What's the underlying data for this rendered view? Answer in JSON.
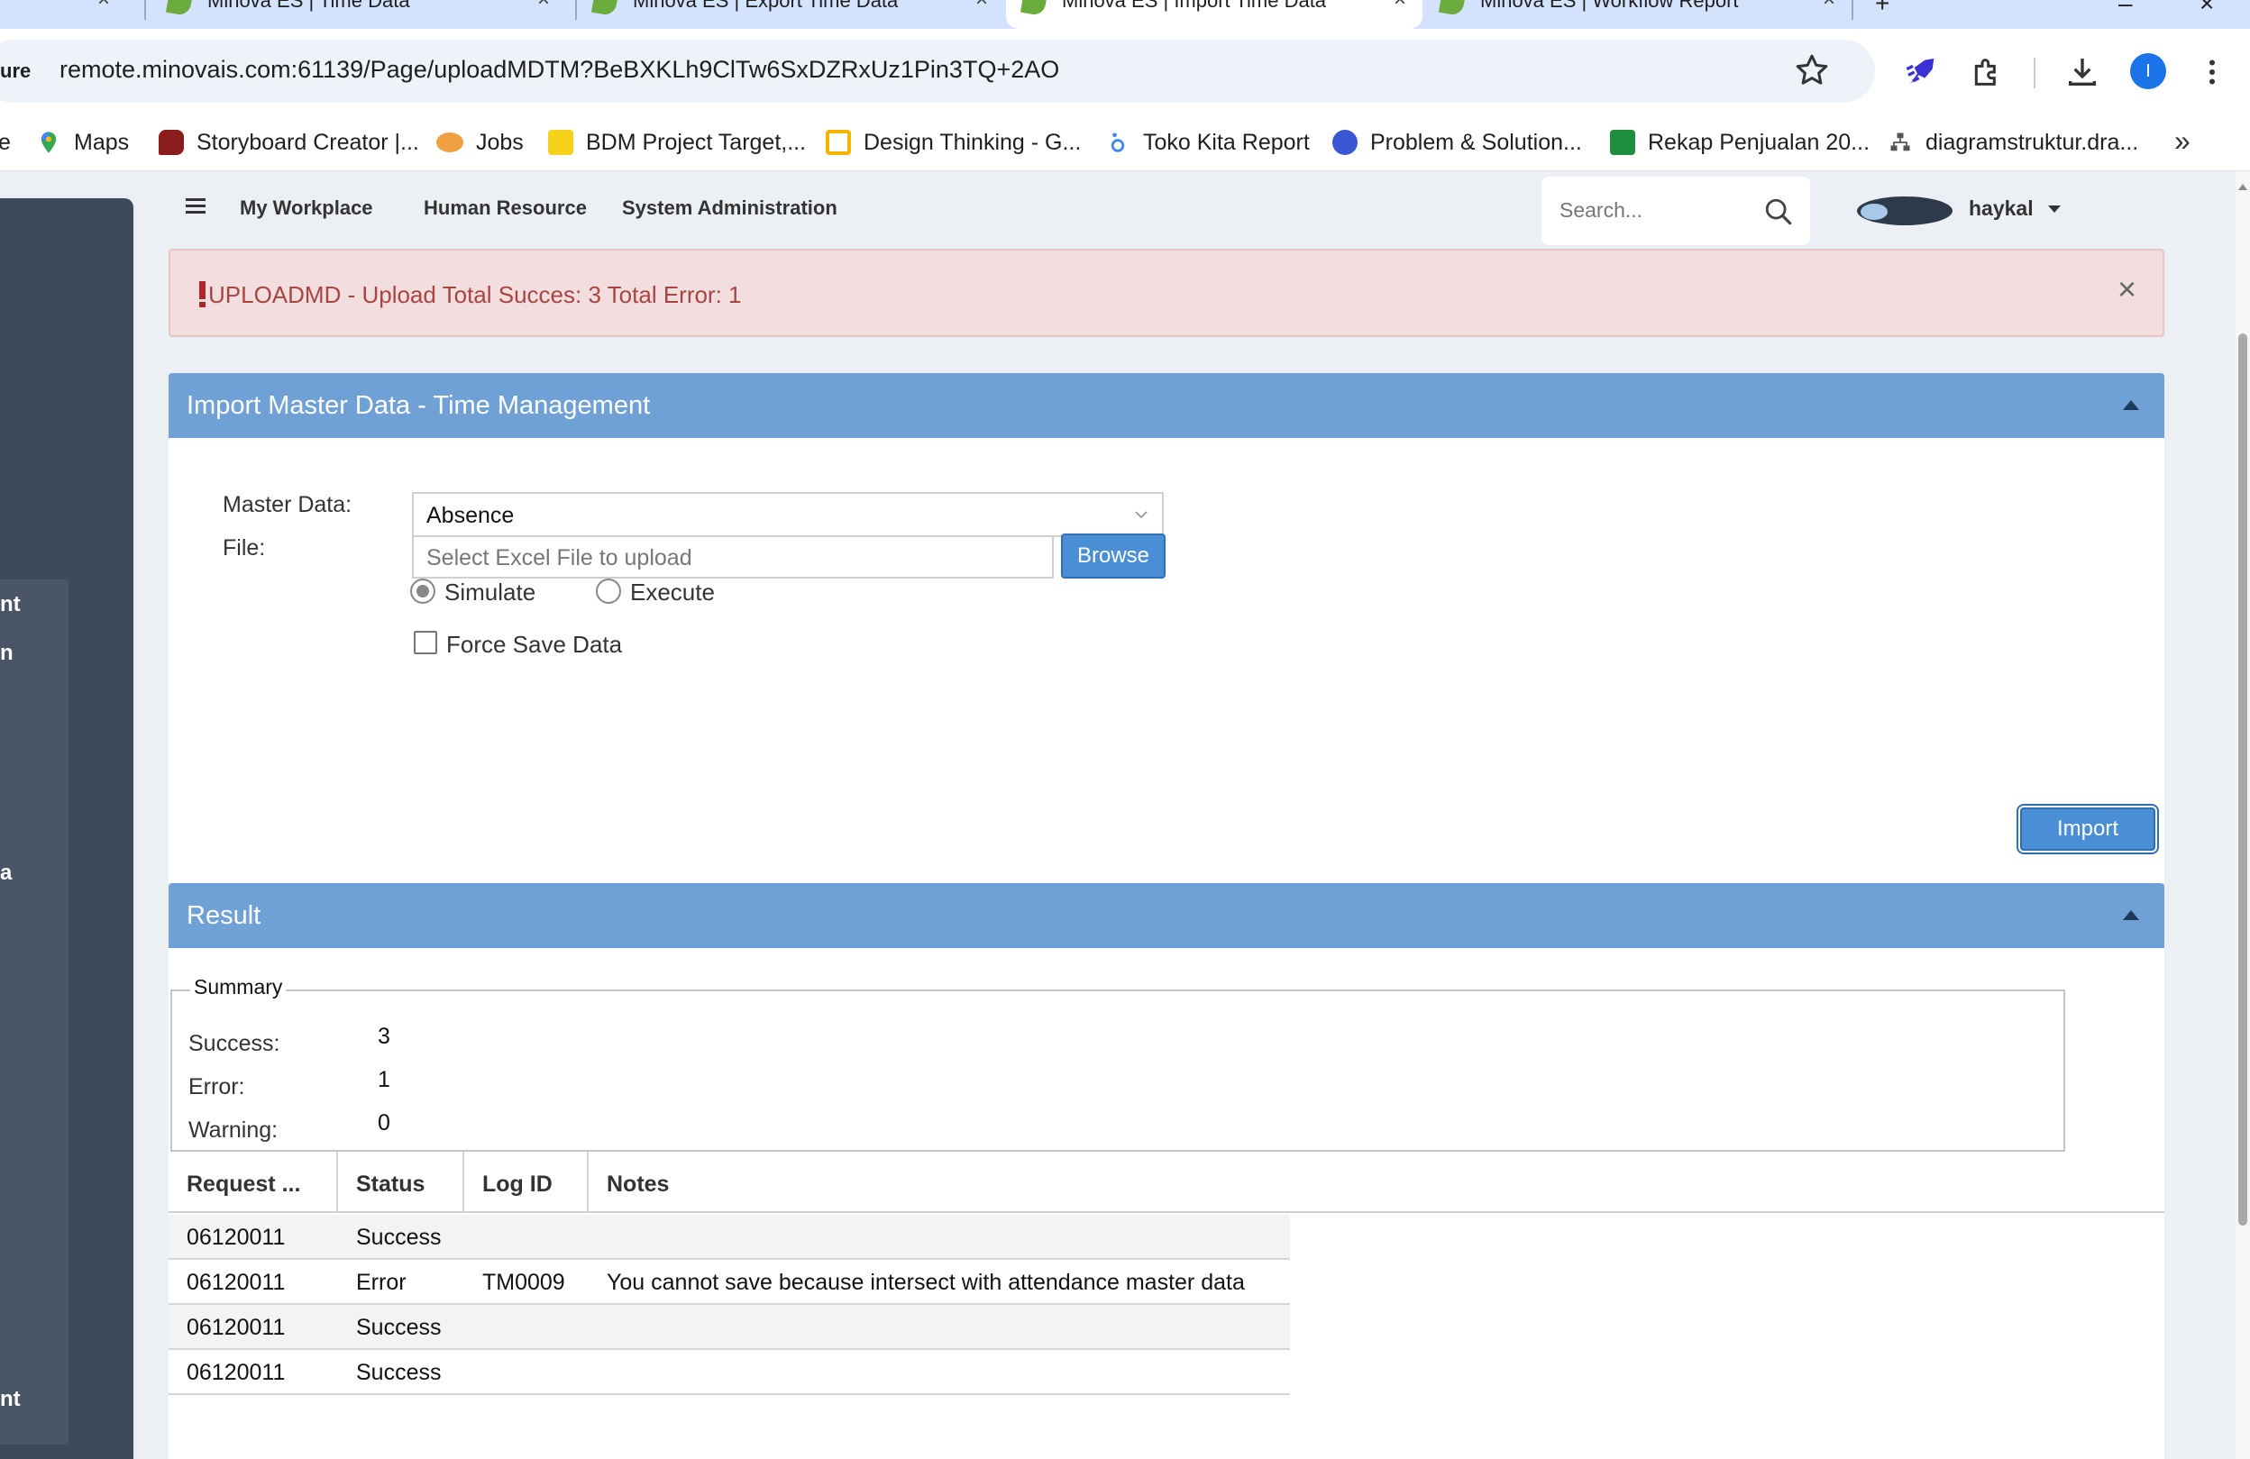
{
  "browser": {
    "tabs": [
      {
        "label": "Minova ES | Time Data"
      },
      {
        "label": "Minova ES | Export Time Data"
      },
      {
        "label": "Minova ES | Import Time Data"
      },
      {
        "label": "Minova ES | Workflow Report"
      }
    ],
    "url_secure_fragment": "ure",
    "url": "remote.minovais.com:61139/Page/uploadMDTM?BeBXKLh9ClTw6SxDZRxUz1Pin3TQ+2AO",
    "profile_initial": "I",
    "bookmarks": [
      {
        "label": "e"
      },
      {
        "label": "Maps"
      },
      {
        "label": "Storyboard Creator |..."
      },
      {
        "label": "Jobs"
      },
      {
        "label": "BDM Project Target,..."
      },
      {
        "label": "Design Thinking - G..."
      },
      {
        "label": "Toko Kita Report"
      },
      {
        "label": "Problem & Solution..."
      },
      {
        "label": "Rekap Penjualan 20..."
      },
      {
        "label": "diagramstruktur.dra..."
      }
    ],
    "more_bookmarks": "»"
  },
  "sidebar": {
    "fragments": [
      "nt",
      "n",
      "a",
      "nt"
    ]
  },
  "topnav": {
    "links": [
      "My Workplace",
      "Human Resource",
      "System Administration"
    ],
    "search_placeholder": "Search...",
    "user_name": "haykal"
  },
  "alert": {
    "message": "UPLOADMD - Upload Total Succes: 3 Total Error: 1",
    "close": "×"
  },
  "import_panel": {
    "title": "Import Master Data - Time Management",
    "master_data_label": "Master Data:",
    "master_data_value": "Absence",
    "file_label": "File:",
    "file_placeholder": "Select Excel File to upload",
    "browse_label": "Browse",
    "mode_options": [
      {
        "label": "Simulate",
        "checked": true
      },
      {
        "label": "Execute",
        "checked": false
      }
    ],
    "force_save_label": "Force Save Data",
    "force_save_checked": false,
    "import_label": "Import"
  },
  "result_panel": {
    "title": "Result",
    "summary": {
      "legend": "Summary",
      "items": [
        {
          "label": "Success:",
          "value": "3"
        },
        {
          "label": "Error:",
          "value": "1"
        },
        {
          "label": "Warning:",
          "value": "0"
        }
      ]
    },
    "grid": {
      "columns": [
        "Request ...",
        "Status",
        "Log ID",
        "Notes"
      ],
      "rows": [
        {
          "request": "06120011",
          "status": "Success",
          "log_id": "",
          "notes": ""
        },
        {
          "request": "06120011",
          "status": "Error",
          "log_id": "TM0009",
          "notes": "You cannot save because intersect with attendance master data"
        },
        {
          "request": "06120011",
          "status": "Success",
          "log_id": "",
          "notes": ""
        },
        {
          "request": "06120011",
          "status": "Success",
          "log_id": "",
          "notes": ""
        }
      ]
    }
  },
  "colors": {
    "panel_header": "#6fa1d7",
    "alert_bg": "#f2dede",
    "alert_text": "#a94442",
    "sidebar": "#3d4a5c",
    "button_blue": "#4a8fd6"
  }
}
